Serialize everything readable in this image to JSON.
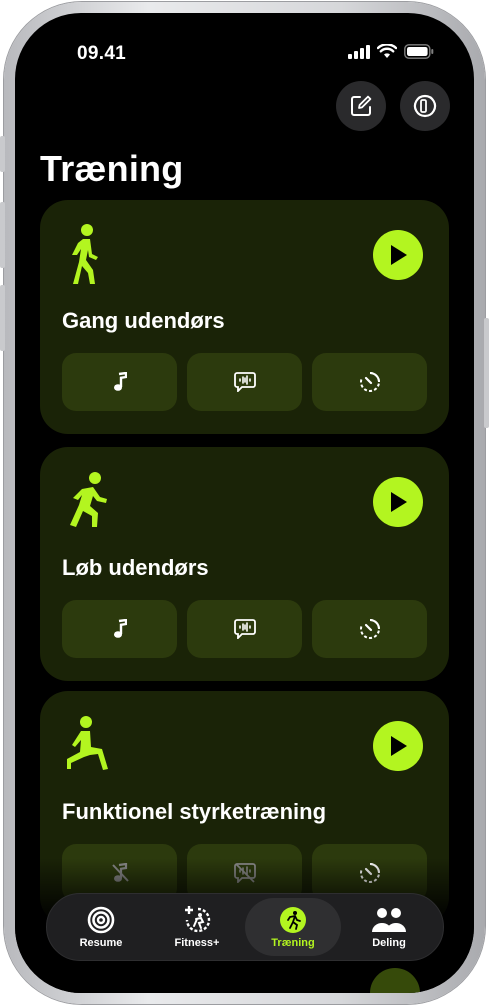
{
  "status_bar": {
    "time": "09.41"
  },
  "header": {
    "edit_icon": "square-pencil-icon",
    "history_icon": "watch-history-icon",
    "title": "Træning"
  },
  "colors": {
    "accent": "#b3f520",
    "card_bg": "#1a2307",
    "pill_bg": "#2c3a0d"
  },
  "workouts": [
    {
      "title": "Gang udendørs",
      "icon": "walking-figure-icon",
      "actions": [
        "music-note-icon",
        "voice-feedback-icon",
        "pacer-timer-icon"
      ]
    },
    {
      "title": "Løb udendørs",
      "icon": "running-figure-icon",
      "actions": [
        "music-note-icon",
        "voice-feedback-icon",
        "pacer-timer-icon"
      ]
    },
    {
      "title": "Funktionel styrketræning",
      "icon": "strength-figure-icon",
      "actions": [
        "music-off-icon",
        "voice-feedback-off-icon",
        "pacer-timer-icon"
      ]
    }
  ],
  "tabbar": {
    "tabs": [
      {
        "label": "Resume",
        "icon": "activity-rings-icon",
        "active": false
      },
      {
        "label": "Fitness+",
        "icon": "fitness-plus-icon",
        "active": false
      },
      {
        "label": "Træning",
        "icon": "running-figure-icon",
        "active": true
      },
      {
        "label": "Deling",
        "icon": "sharing-people-icon",
        "active": false
      }
    ]
  }
}
